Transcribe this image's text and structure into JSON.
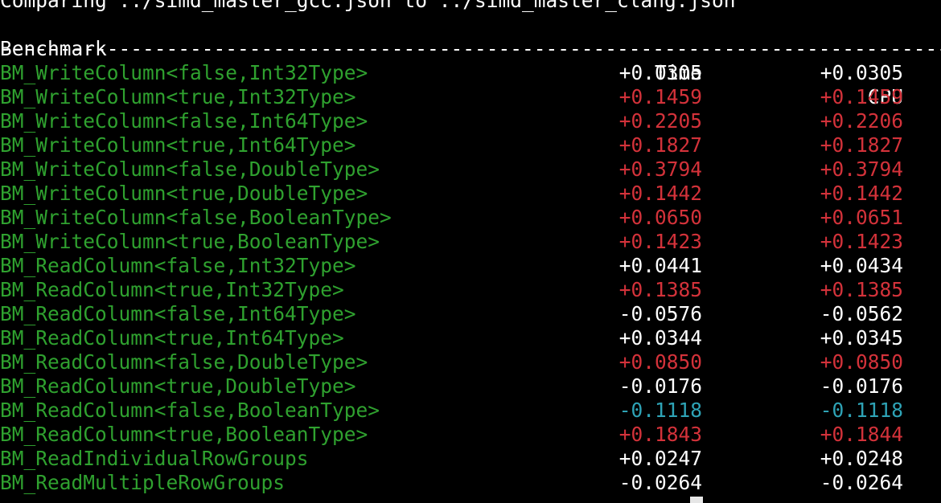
{
  "terminal": {
    "compare_line": "Comparing ../simd_master_gcc.json to ../simd_master_clang.json",
    "headers": {
      "benchmark": "Benchmark",
      "time": "Time",
      "cpu": "CPU"
    },
    "separator": "------------------------------------------------------------------------------------------------",
    "rows": [
      {
        "name": "BM_WriteColumn<false,Int32Type>",
        "time": "+0.0305",
        "cpu": "+0.0305",
        "time_color": "white",
        "cpu_color": "white"
      },
      {
        "name": "BM_WriteColumn<true,Int32Type>",
        "time": "+0.1459",
        "cpu": "+0.1459",
        "time_color": "red",
        "cpu_color": "red"
      },
      {
        "name": "BM_WriteColumn<false,Int64Type>",
        "time": "+0.2205",
        "cpu": "+0.2206",
        "time_color": "red",
        "cpu_color": "red"
      },
      {
        "name": "BM_WriteColumn<true,Int64Type>",
        "time": "+0.1827",
        "cpu": "+0.1827",
        "time_color": "red",
        "cpu_color": "red"
      },
      {
        "name": "BM_WriteColumn<false,DoubleType>",
        "time": "+0.3794",
        "cpu": "+0.3794",
        "time_color": "red",
        "cpu_color": "red"
      },
      {
        "name": "BM_WriteColumn<true,DoubleType>",
        "time": "+0.1442",
        "cpu": "+0.1442",
        "time_color": "red",
        "cpu_color": "red"
      },
      {
        "name": "BM_WriteColumn<false,BooleanType>",
        "time": "+0.0650",
        "cpu": "+0.0651",
        "time_color": "red",
        "cpu_color": "red"
      },
      {
        "name": "BM_WriteColumn<true,BooleanType>",
        "time": "+0.1423",
        "cpu": "+0.1423",
        "time_color": "red",
        "cpu_color": "red"
      },
      {
        "name": "BM_ReadColumn<false,Int32Type>",
        "time": "+0.0441",
        "cpu": "+0.0434",
        "time_color": "white",
        "cpu_color": "white"
      },
      {
        "name": "BM_ReadColumn<true,Int32Type>",
        "time": "+0.1385",
        "cpu": "+0.1385",
        "time_color": "red",
        "cpu_color": "red"
      },
      {
        "name": "BM_ReadColumn<false,Int64Type>",
        "time": "-0.0576",
        "cpu": "-0.0562",
        "time_color": "white",
        "cpu_color": "white"
      },
      {
        "name": "BM_ReadColumn<true,Int64Type>",
        "time": "+0.0344",
        "cpu": "+0.0345",
        "time_color": "white",
        "cpu_color": "white"
      },
      {
        "name": "BM_ReadColumn<false,DoubleType>",
        "time": "+0.0850",
        "cpu": "+0.0850",
        "time_color": "red",
        "cpu_color": "red"
      },
      {
        "name": "BM_ReadColumn<true,DoubleType>",
        "time": "-0.0176",
        "cpu": "-0.0176",
        "time_color": "white",
        "cpu_color": "white"
      },
      {
        "name": "BM_ReadColumn<false,BooleanType>",
        "time": "-0.1118",
        "cpu": "-0.1118",
        "time_color": "cyan",
        "cpu_color": "cyan"
      },
      {
        "name": "BM_ReadColumn<true,BooleanType>",
        "time": "+0.1843",
        "cpu": "+0.1844",
        "time_color": "red",
        "cpu_color": "red"
      },
      {
        "name": "BM_ReadIndividualRowGroups",
        "time": "+0.0247",
        "cpu": "+0.0248",
        "time_color": "white",
        "cpu_color": "white"
      },
      {
        "name": "BM_ReadMultipleRowGroups",
        "time": "-0.0264",
        "cpu": "-0.0264",
        "time_color": "white",
        "cpu_color": "white"
      }
    ]
  },
  "colors": {
    "background": "#000000",
    "name": "#2fa12f",
    "red": "#d3323a",
    "cyan": "#2ea3b6",
    "white": "#ffffff"
  }
}
